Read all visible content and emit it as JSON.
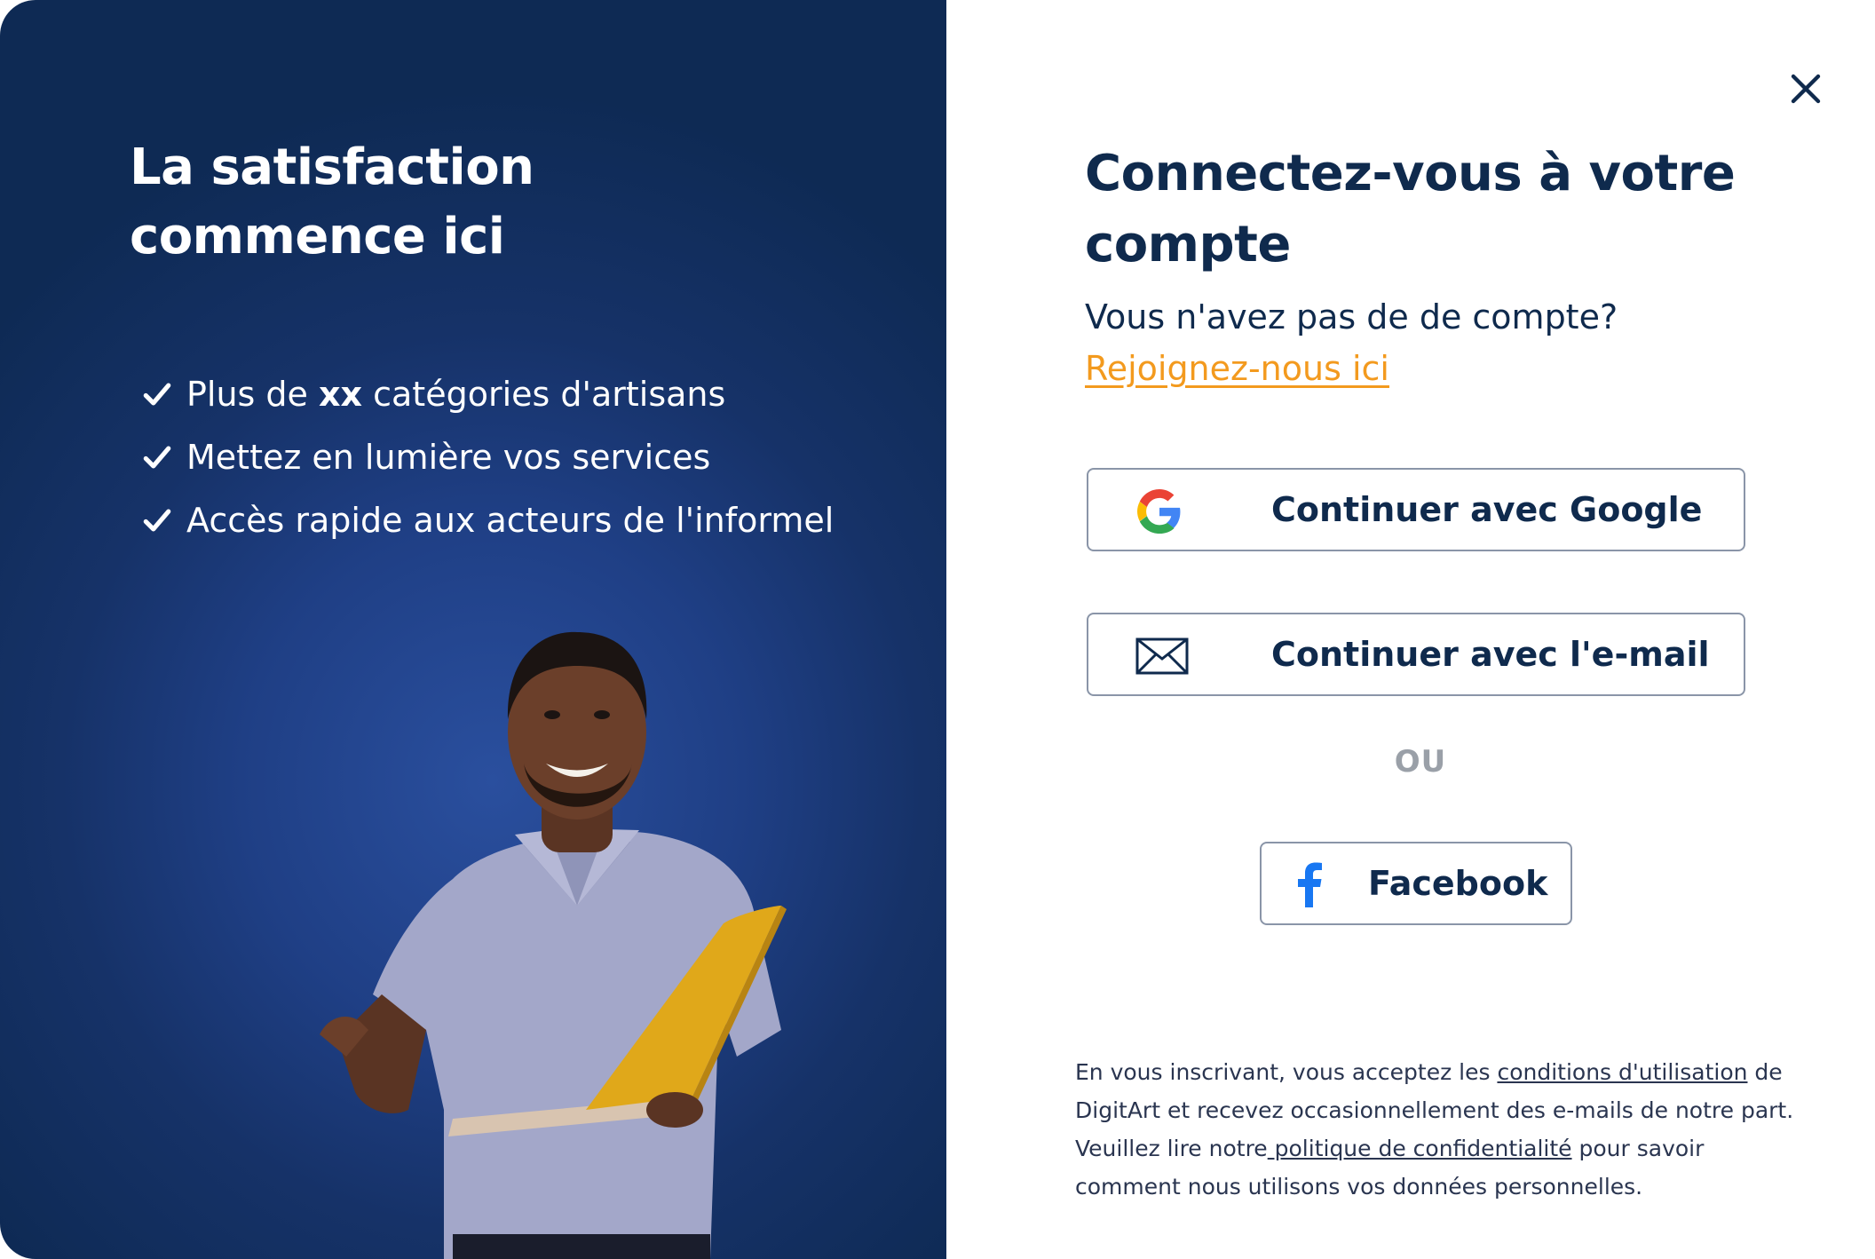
{
  "left_panel": {
    "title": "La satisfaction commence ici",
    "features": [
      {
        "before": "Plus de ",
        "bold": "xx",
        "after": " catégories d'artisans"
      },
      {
        "before": "Mettez en lumière vos services",
        "bold": "",
        "after": ""
      },
      {
        "before": "Accès rapide aux acteurs de l'informel",
        "bold": "",
        "after": ""
      }
    ]
  },
  "login": {
    "title": "Connectez-vous à votre compte",
    "no_account": "Vous n'avez pas de de compte?",
    "join_link": "Rejoignez-nous ici",
    "google_label": "Continuer avec Google",
    "email_label": "Continuer avec l'e-mail",
    "separator": "OU",
    "facebook_label": "Facebook"
  },
  "legal": {
    "part1": "En vous inscrivant, vous acceptez les ",
    "terms_link": "conditions d'utilisation",
    "part2": " de DigitArt et recevez occasionnellement des e-mails de notre part. Veuillez lire notre",
    "privacy_link": " politique de confidentialité",
    "part3": " pour savoir comment nous utilisons vos données personnelles."
  },
  "icons": {
    "close": "close-icon",
    "check": "check-icon",
    "google": "google-icon",
    "email": "envelope-icon",
    "facebook": "facebook-icon"
  },
  "colors": {
    "panel_dark": "#0e2a54",
    "panel_light": "#2a4f9e",
    "text_navy": "#0f2a4d",
    "link_orange": "#f39a1e",
    "separator_gray": "#9aa0a8",
    "facebook_blue": "#1877f2"
  }
}
